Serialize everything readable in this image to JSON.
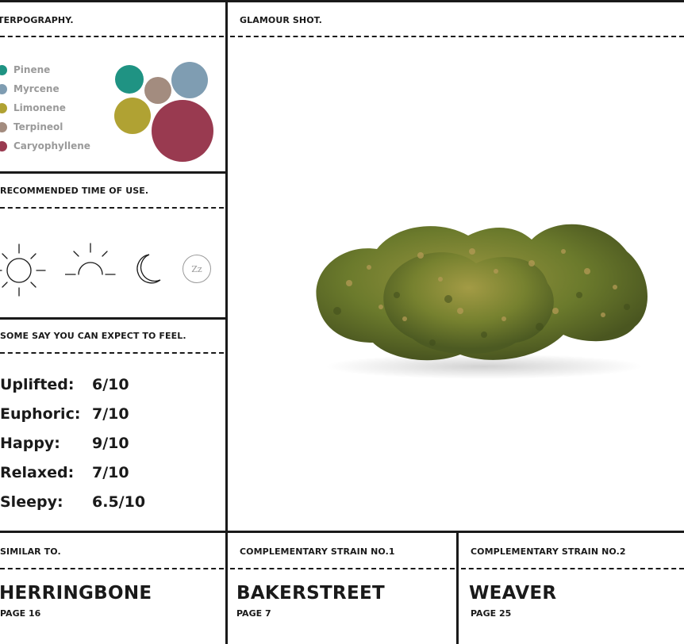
{
  "sections": {
    "terpography": "TERPOGRAPHY.",
    "glamour": "GLAMOUR SHOT.",
    "time_of_use": "RECOMMENDED TIME OF USE.",
    "feel": "SOME SAY YOU CAN EXPECT TO FEEL.",
    "similar": "SIMILAR TO.",
    "comp1": "COMPLEMENTARY STRAIN NO.1",
    "comp2": "COMPLEMENTARY STRAIN NO.2"
  },
  "terpenes": [
    {
      "name": "Pinene",
      "color": "#1f9383"
    },
    {
      "name": "Myrcene",
      "color": "#7f9db2"
    },
    {
      "name": "Limonene",
      "color": "#b0a233"
    },
    {
      "name": "Terpineol",
      "color": "#a38c7f"
    },
    {
      "name": "Caryophyllene",
      "color": "#993a50"
    }
  ],
  "time_icons": [
    "sun-icon",
    "sunrise-icon",
    "moon-icon",
    "sleep-icon"
  ],
  "sleep_glyph": "Zz",
  "effects": [
    {
      "name": "Uplifted:",
      "rating": "6/10"
    },
    {
      "name": "Euphoric:",
      "rating": "7/10"
    },
    {
      "name": "Happy:",
      "rating": "9/10"
    },
    {
      "name": "Relaxed:",
      "rating": "7/10"
    },
    {
      "name": "Sleepy:",
      "rating": "6.5/10"
    }
  ],
  "similar": {
    "name": "HERRINGBONE",
    "page": "PAGE 16"
  },
  "comp1": {
    "name": "BAKERSTREET",
    "page": "PAGE 7"
  },
  "comp2": {
    "name": "WEAVER",
    "page": "PAGE 25"
  },
  "colors": {
    "ink": "#1a1a1a",
    "legend_text": "#9a9a9a",
    "bud_dark": "#5a6a24",
    "bud_light": "#8e8a3a"
  }
}
